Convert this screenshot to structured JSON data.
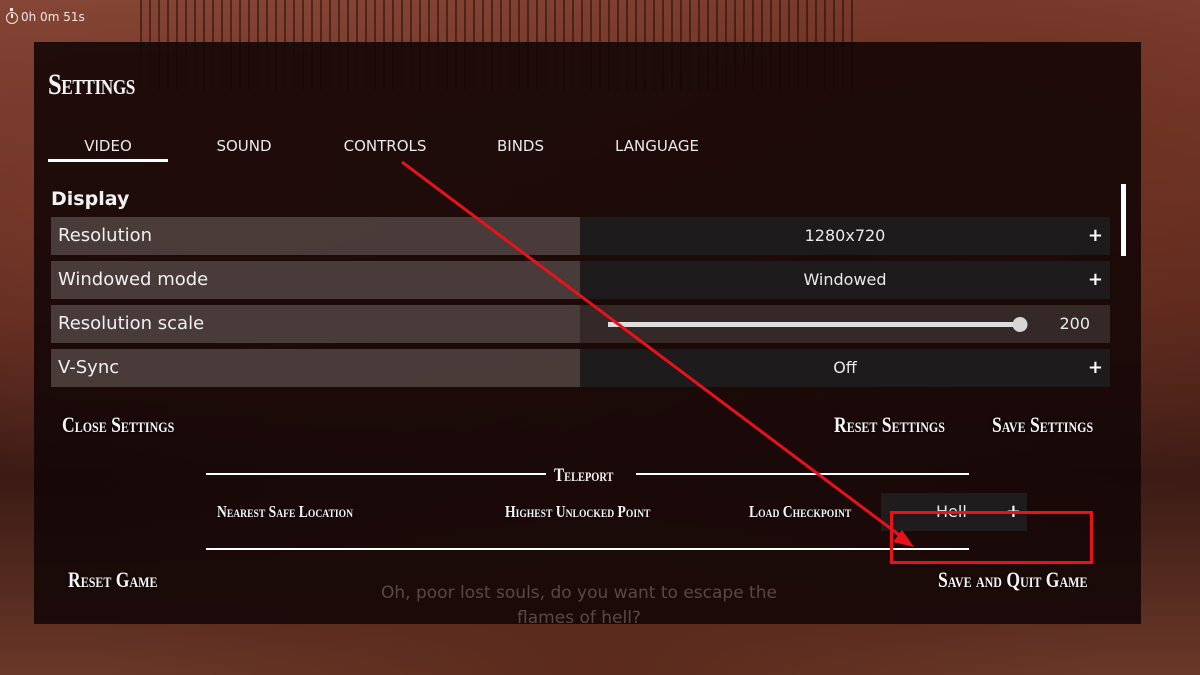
{
  "hud": {
    "timer_icon": "stopwatch-icon",
    "timer_text": "0h 0m 51s"
  },
  "settings": {
    "title": "Settings",
    "tabs": [
      {
        "label": "VIDEO",
        "active": true
      },
      {
        "label": "SOUND",
        "active": false
      },
      {
        "label": "CONTROLS",
        "active": false
      },
      {
        "label": "BINDS",
        "active": false
      },
      {
        "label": "LANGUAGE",
        "active": false
      }
    ],
    "section": "Display",
    "rows": [
      {
        "label": "Resolution",
        "value": "1280x720",
        "control": "select",
        "icon": "plus-icon"
      },
      {
        "label": "Windowed mode",
        "value": "Windowed",
        "control": "select",
        "icon": "plus-icon"
      },
      {
        "label": "Resolution scale",
        "value": "200",
        "control": "slider",
        "slider_fraction": 1.0
      },
      {
        "label": "V-Sync",
        "value": "Off",
        "control": "select",
        "icon": "plus-icon"
      }
    ],
    "buttons": {
      "close": "Close Settings",
      "reset": "Reset Settings",
      "save": "Save Settings"
    }
  },
  "teleport": {
    "title": "Teleport",
    "nearest": "Nearest Safe Location",
    "highest": "Highest Unlocked Point",
    "load_checkpoint": "Load Checkpoint",
    "checkpoint_value": "Hell"
  },
  "game": {
    "reset": "Reset Game",
    "save_quit": "Save and Quit Game",
    "quote": "Oh, poor lost souls, do you want to escape the flames of hell?"
  },
  "annotation": {
    "arrow_color": "#e8121a",
    "highlight_color": "#e8121a"
  }
}
